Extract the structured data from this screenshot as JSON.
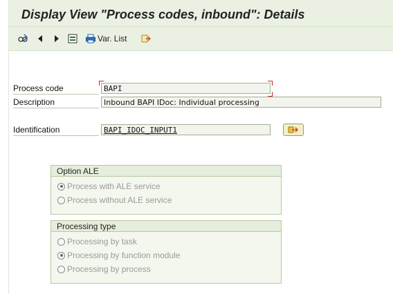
{
  "window": {
    "title": "Display View \"Process codes, inbound\": Details"
  },
  "toolbar": {
    "items": [
      {
        "icon": "glasses-change-icon"
      },
      {
        "icon": "previous-arrow-icon"
      },
      {
        "icon": "next-arrow-icon"
      },
      {
        "icon": "select-block-icon"
      },
      {
        "icon": "printer-icon",
        "label": "Var. List"
      },
      {
        "icon": "export-icon"
      }
    ]
  },
  "form": {
    "process_code": {
      "label": "Process code",
      "value": "BAPI"
    },
    "description": {
      "label": "Description",
      "value": "Inbound BAPI IDoc: Individual processing"
    },
    "identification": {
      "label": "Identification",
      "value": "BAPI_IDOC_INPUT1"
    }
  },
  "option_ale": {
    "title": "Option ALE",
    "options": [
      {
        "label": "Process with ALE service",
        "selected": true
      },
      {
        "label": "Process without ALE service",
        "selected": false
      }
    ]
  },
  "processing_type": {
    "title": "Processing type",
    "options": [
      {
        "label": "Processing by task",
        "selected": false
      },
      {
        "label": "Processing by function module",
        "selected": true
      },
      {
        "label": "Processing by process",
        "selected": false
      }
    ]
  },
  "colors": {
    "background": "#eaf1e3",
    "group_border": "#b5c8a3",
    "disabled_text": "#9a9a9a",
    "required_marker": "#d12020"
  }
}
